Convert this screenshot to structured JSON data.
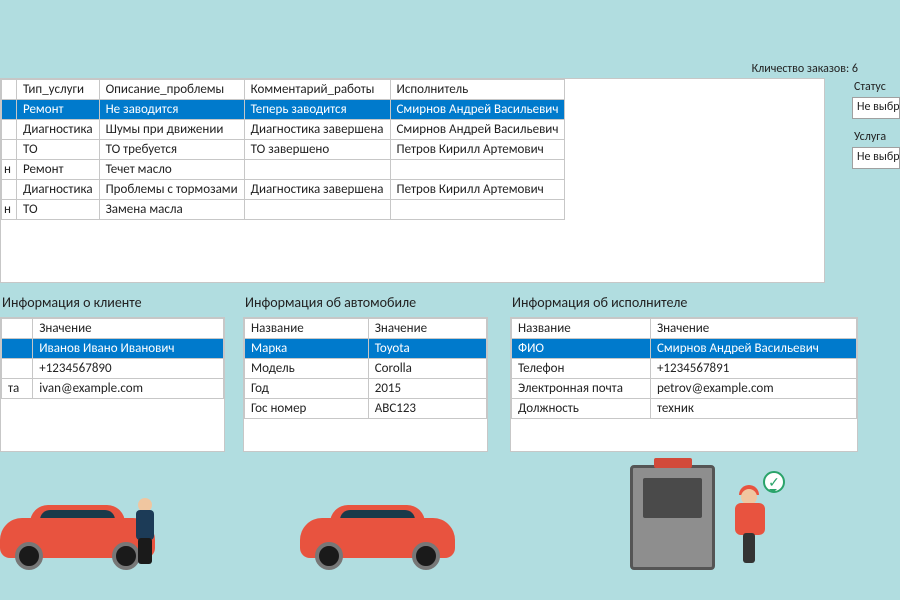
{
  "orders_count_label": "Кличество заказов: 6",
  "filters": {
    "status_label": "Статус",
    "status_value": "Не выбрано",
    "service_label": "Услуга",
    "service_value": "Не выбрано"
  },
  "orders": {
    "headers": [
      "",
      "Тип_услуги",
      "Описание_проблемы",
      "Комментарий_работы",
      "Исполнитель"
    ],
    "rows": [
      {
        "c0": "",
        "type": "Ремонт",
        "problem": "Не заводится",
        "comment": "Теперь заводится",
        "performer": "Смирнов Андрей Васильевич",
        "selected": true
      },
      {
        "c0": "",
        "type": "Диагностика",
        "problem": "Шумы при движении",
        "comment": "Диагностика завершена",
        "performer": "Смирнов Андрей Васильевич"
      },
      {
        "c0": "",
        "type": "ТО",
        "problem": "ТО требуется",
        "comment": "ТО завершено",
        "performer": "Петров Кирилл Артемович"
      },
      {
        "c0": "н",
        "type": "Ремонт",
        "problem": "Течет масло",
        "comment": "",
        "performer": ""
      },
      {
        "c0": "",
        "type": "Диагностика",
        "problem": "Проблемы с тормозами",
        "comment": "Диагностика завершена",
        "performer": "Петров Кирилл Артемович"
      },
      {
        "c0": "н",
        "type": "ТО",
        "problem": "Замена масла",
        "comment": "",
        "performer": ""
      }
    ]
  },
  "client": {
    "title": "Информация о клиенте",
    "headers": [
      "",
      "Значение"
    ],
    "rows": [
      {
        "k": "",
        "v": "Иванов Ивано Иванович",
        "selected": true
      },
      {
        "k": "",
        "v": "+1234567890"
      },
      {
        "k": "та",
        "v": "ivan@example.com"
      }
    ]
  },
  "car": {
    "title": "Информация об автомобиле",
    "headers": [
      "Название",
      "Значение"
    ],
    "rows": [
      {
        "k": "Марка",
        "v": "Toyota",
        "selected": true
      },
      {
        "k": "Модель",
        "v": "Corolla"
      },
      {
        "k": "Год",
        "v": "2015"
      },
      {
        "k": "Гос номер",
        "v": "ABC123"
      }
    ]
  },
  "performer": {
    "title": "Информация об исполнителе",
    "headers": [
      "Название",
      "Значение"
    ],
    "rows": [
      {
        "k": "ФИО",
        "v": "Смирнов Андрей Васильевич",
        "selected": true
      },
      {
        "k": "Телефон",
        "v": "+1234567891"
      },
      {
        "k": "Электронная почта",
        "v": "petrov@example.com"
      },
      {
        "k": "Должность",
        "v": "техник"
      }
    ]
  }
}
